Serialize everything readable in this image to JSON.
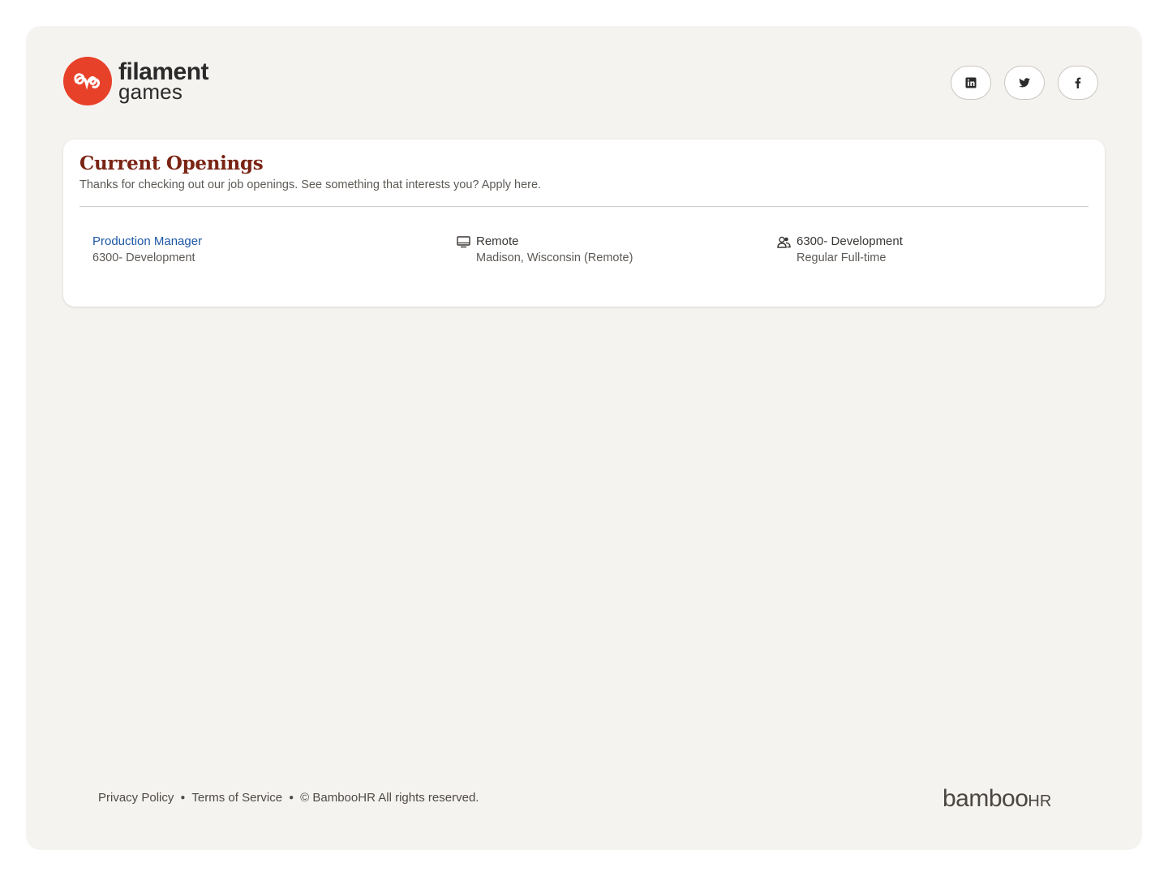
{
  "brand": {
    "line1": "filament",
    "line2": "games",
    "accent": "#e8412a"
  },
  "social": [
    {
      "name": "linkedin",
      "icon": "linkedin-icon"
    },
    {
      "name": "twitter",
      "icon": "twitter-icon"
    },
    {
      "name": "facebook",
      "icon": "facebook-icon"
    }
  ],
  "openings": {
    "title": "Current Openings",
    "subtitle": "Thanks for checking out our job openings. See something that interests you? Apply here.",
    "jobs": [
      {
        "title": "Production Manager",
        "department": "6300- Development",
        "location_type": "Remote",
        "location": "Madison, Wisconsin (Remote)",
        "team": "6300- Development",
        "employment_type": "Regular Full-time"
      }
    ]
  },
  "footer": {
    "privacy": "Privacy Policy",
    "terms": "Terms of Service",
    "copyright": "© BambooHR All rights reserved.",
    "powered_by": "bamboo",
    "powered_by_suffix": "HR"
  },
  "colors": {
    "title": "#7a2414",
    "link": "#1d57a6",
    "background": "#f5f3f0"
  }
}
